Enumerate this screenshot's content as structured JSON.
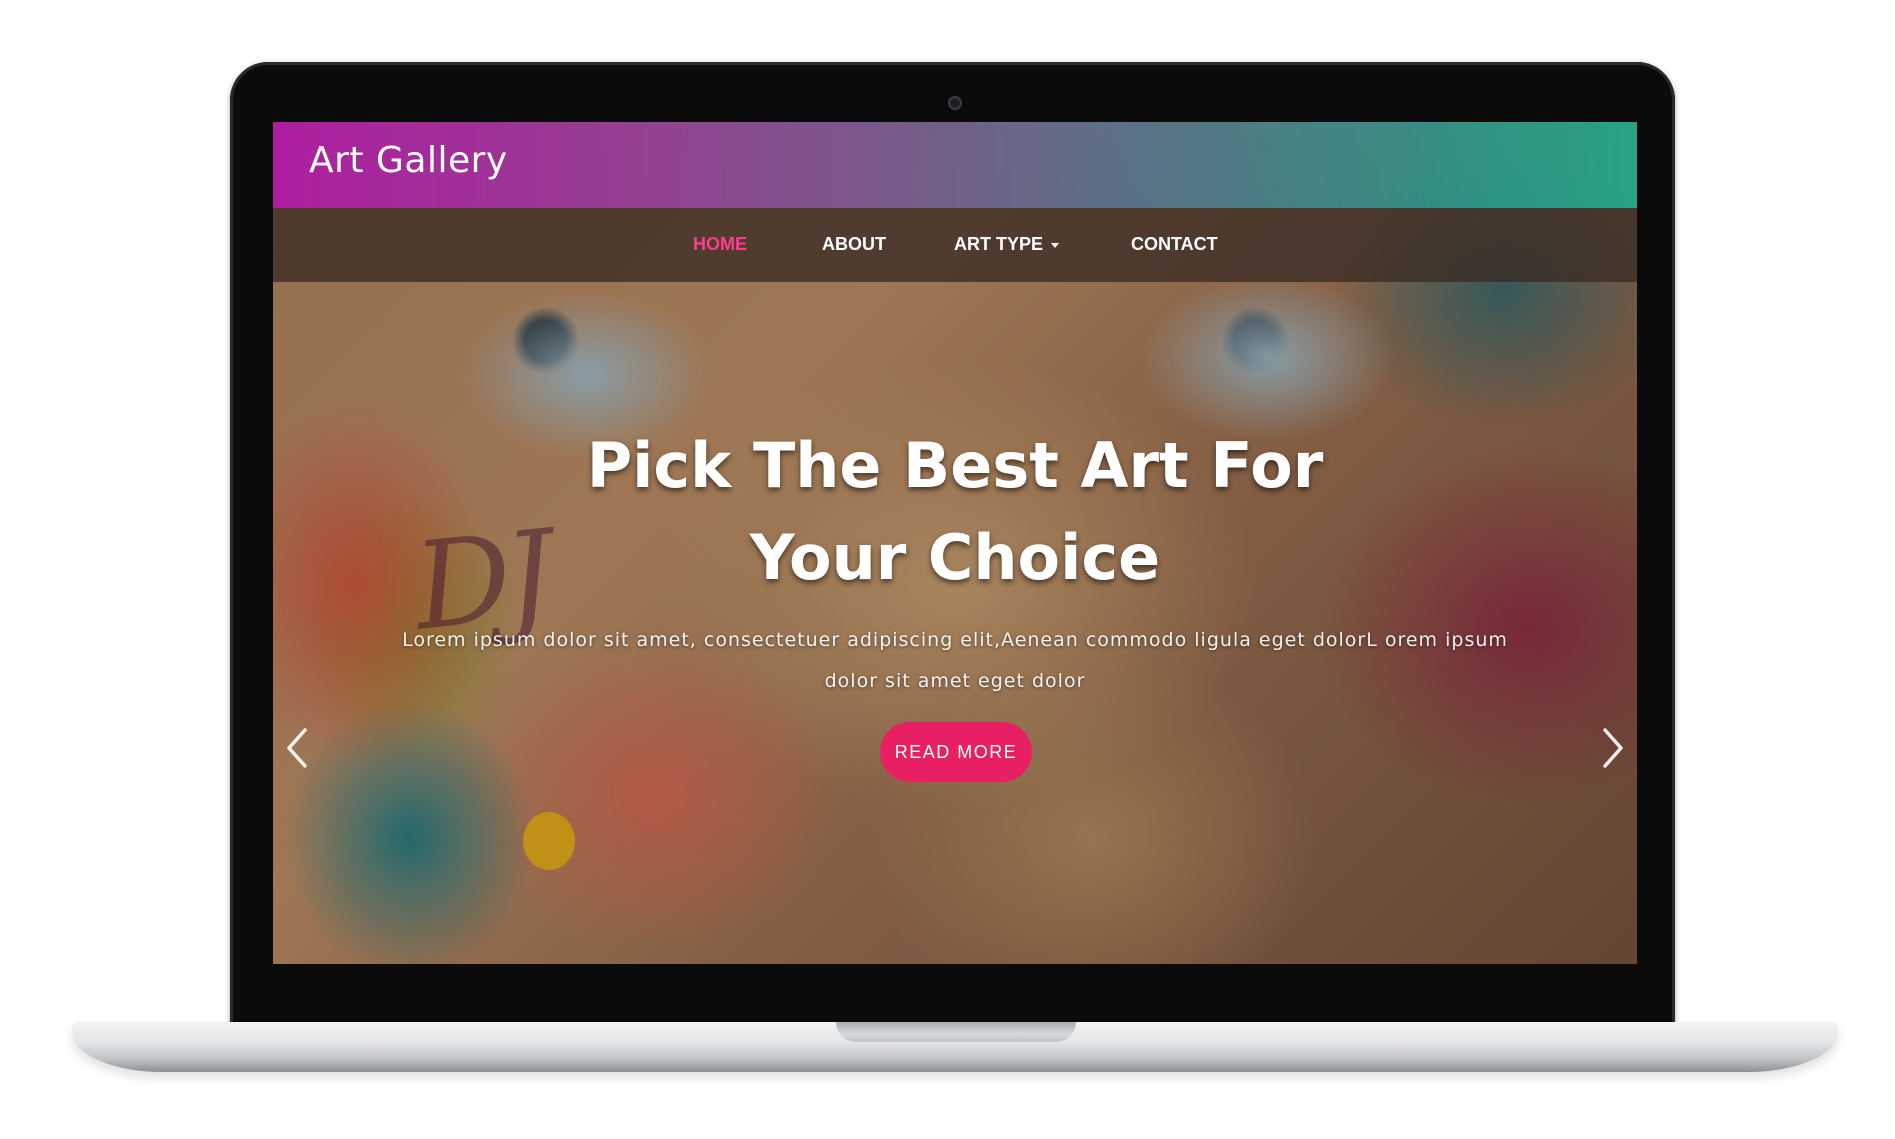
{
  "site": {
    "logo": "Art Gallery"
  },
  "nav": {
    "items": [
      {
        "label": "HOME",
        "active": true
      },
      {
        "label": "ABOUT",
        "active": false
      },
      {
        "label": "ART TYPE",
        "active": false,
        "has_dropdown": true
      },
      {
        "label": "CONTACT",
        "active": false
      }
    ]
  },
  "hero": {
    "title_line1": "Pick The Best Art For",
    "title_line2": "Your Choice",
    "text": "Lorem ipsum dolor sit amet, consectetuer adipiscing elit,Aenean commodo ligula eget dolorL orem ipsum dolor sit amet eget dolor",
    "button_label": "READ MORE"
  },
  "carousel": {
    "prev_icon": "chevron-left-icon",
    "next_icon": "chevron-right-icon"
  },
  "colors": {
    "accent": "#e81f63",
    "active_nav": "#ff3d8c",
    "header_gradient_start": "#b017a8",
    "header_gradient_end": "#1eaa8c"
  }
}
